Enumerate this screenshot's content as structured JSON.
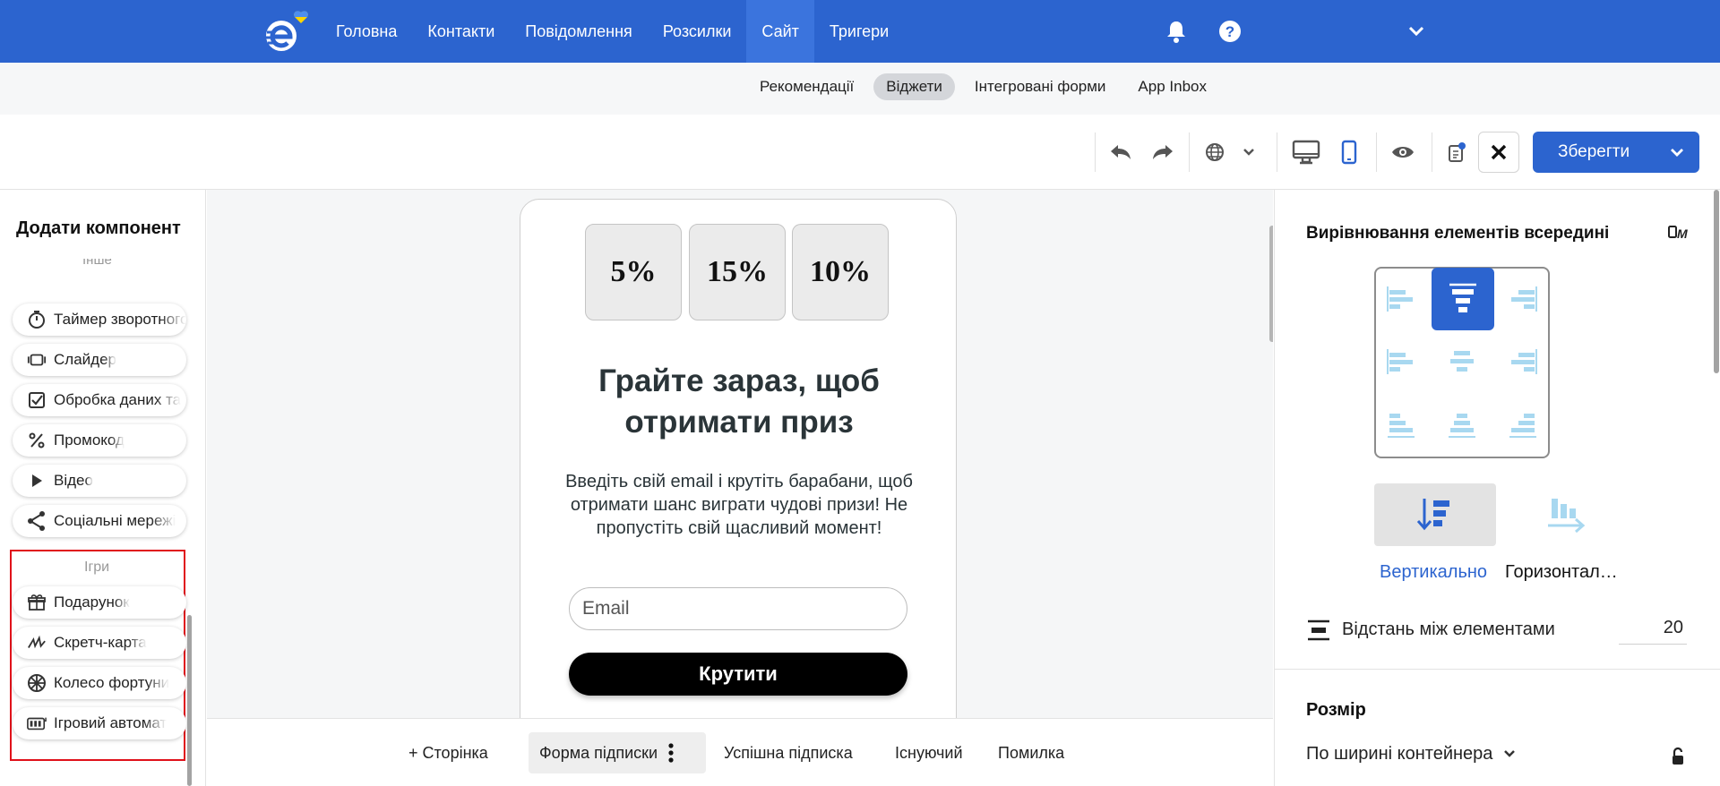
{
  "colors": {
    "primary": "#2c64cf",
    "highlight_border": "#e0101a",
    "light_blue_icon": "#a8d8f0"
  },
  "topnav": {
    "logo_icon": "esputnik-logo-with-heart",
    "items": [
      {
        "label": "Головна"
      },
      {
        "label": "Контакти"
      },
      {
        "label": "Повідомлення"
      },
      {
        "label": "Розсилки"
      },
      {
        "label": "Сайт",
        "active": true
      },
      {
        "label": "Тригери"
      }
    ],
    "icons": [
      "bell-icon",
      "help-icon",
      "chevron-down-icon"
    ]
  },
  "subnav": {
    "items": [
      {
        "label": "Рекомендації"
      },
      {
        "label": "Віджети",
        "active": true
      },
      {
        "label": "Інтегровані форми"
      },
      {
        "label": "App Inbox"
      }
    ]
  },
  "toolbar": {
    "icons": [
      "undo-icon",
      "redo-icon",
      "globe-icon",
      "chevron-down-icon",
      "desktop-icon",
      "mobile-icon",
      "eye-icon",
      "notes-icon",
      "close-icon"
    ],
    "save_label": "Зберегти"
  },
  "left_panel": {
    "title": "Додати компонент",
    "partial_category": "Інше",
    "components": [
      {
        "label": "Таймер зворотного відліку",
        "icon": "timer-icon"
      },
      {
        "label": "Слайдер",
        "icon": "slider-icon"
      },
      {
        "label": "Обробка даних та",
        "icon": "checkbox-icon"
      },
      {
        "label": "Промокод",
        "icon": "percent-icon"
      },
      {
        "label": "Відео",
        "icon": "play-icon"
      },
      {
        "label": "Соціальні мережі",
        "icon": "share-icon"
      }
    ],
    "games_title": "Ігри",
    "games": [
      {
        "label": "Подарунок",
        "icon": "gift-icon"
      },
      {
        "label": "Скретч-карта",
        "icon": "scratch-card-icon"
      },
      {
        "label": "Колесо фортуни",
        "icon": "wheel-icon"
      },
      {
        "label": "Ігровий автомат",
        "icon": "slot-machine-icon"
      }
    ]
  },
  "widget": {
    "slots": [
      "5%",
      "15%",
      "10%"
    ],
    "title": "Грайте зараз, щоб отримати приз",
    "description": "Введіть свій email і крутіть барабани, щоб отримати шанс виграти чудові призи! Не пропустіть свій щасливий момент!",
    "email_placeholder": "Email",
    "button_label": "Крутити"
  },
  "page_tabs": {
    "add_label": "+ Сторінка",
    "tabs": [
      {
        "label": "Форма підписки",
        "active": true
      },
      {
        "label": "Успішна підписка"
      },
      {
        "label": "Існуючий"
      },
      {
        "label": "Помилка"
      }
    ]
  },
  "right_panel": {
    "alignment_title": "Вирівнювання елементів всередині",
    "pin_icon": "mobile-pin-icon",
    "direction_vertical": "Вертикально",
    "direction_horizontal": "Горизонтально",
    "spacing_label": "Відстань між елементами",
    "spacing_value": "20",
    "size_title": "Розмір",
    "size_value": "По ширині контейнера"
  }
}
